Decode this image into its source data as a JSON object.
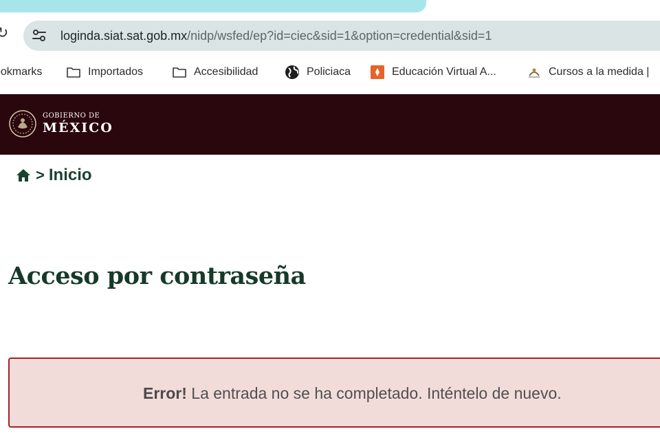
{
  "browser": {
    "address_bar": {
      "url_host": "loginda.siat.sat.gob.mx",
      "url_path": "/nidp/wsfed/ep?id=ciec&sid=1&option=credential&sid=1",
      "site_info_icon": "tune-icon"
    },
    "bookmarks": [
      {
        "label": "ookmarks",
        "icon": "none"
      },
      {
        "label": "Importados",
        "icon": "folder-icon"
      },
      {
        "label": "Accesibilidad",
        "icon": "folder-icon"
      },
      {
        "label": "Policiaca",
        "icon": "globe-icon"
      },
      {
        "label": "Educación Virtual A...",
        "icon": "orange-favicon"
      },
      {
        "label": "Cursos a la medida |",
        "icon": "small-favicon"
      }
    ],
    "tab_color": "#a6e6ea"
  },
  "header": {
    "logo_small": "GOBIERNO DE",
    "logo_big": "MÉXICO",
    "background_color": "#2a070d"
  },
  "breadcrumb": {
    "separator": ">",
    "label": "Inicio"
  },
  "page": {
    "title": "Acceso por contraseña"
  },
  "alert": {
    "strong": "Error!",
    "message": " La entrada no se ha completado. Inténtelo de nuevo.",
    "border_color": "#a2202a",
    "background_color": "#f2dcd9"
  }
}
